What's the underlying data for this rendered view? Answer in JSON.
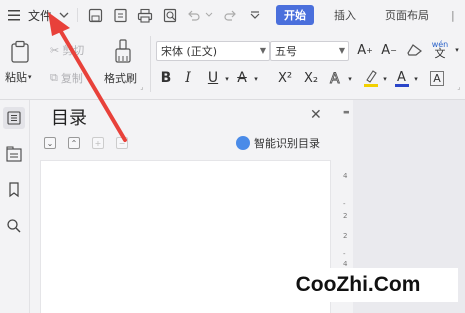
{
  "menubar": {
    "file_label": "文件",
    "tabs": [
      {
        "label": "开始",
        "active": true
      },
      {
        "label": "插入",
        "active": false
      },
      {
        "label": "页面布局",
        "active": false
      }
    ]
  },
  "ribbon": {
    "paste_label": "粘贴",
    "cut_label": "剪切",
    "copy_label": "复制",
    "format_painter_label": "格式刷",
    "font_name": "宋体 (正文)",
    "font_size": "五号",
    "bold": "B",
    "italic": "I",
    "underline": "U",
    "superscript": "X²",
    "subscript": "X₂",
    "phonetic": "wén",
    "char_border": "A"
  },
  "toc": {
    "title": "目录",
    "smart_label": "智能识别目录"
  },
  "ruler": {
    "ticks": [
      "4",
      "2",
      "2",
      "4"
    ]
  },
  "watermark": "CooZhi.Com",
  "colors": {
    "accent": "#4a6fdc",
    "arrow": "#e8413a"
  }
}
